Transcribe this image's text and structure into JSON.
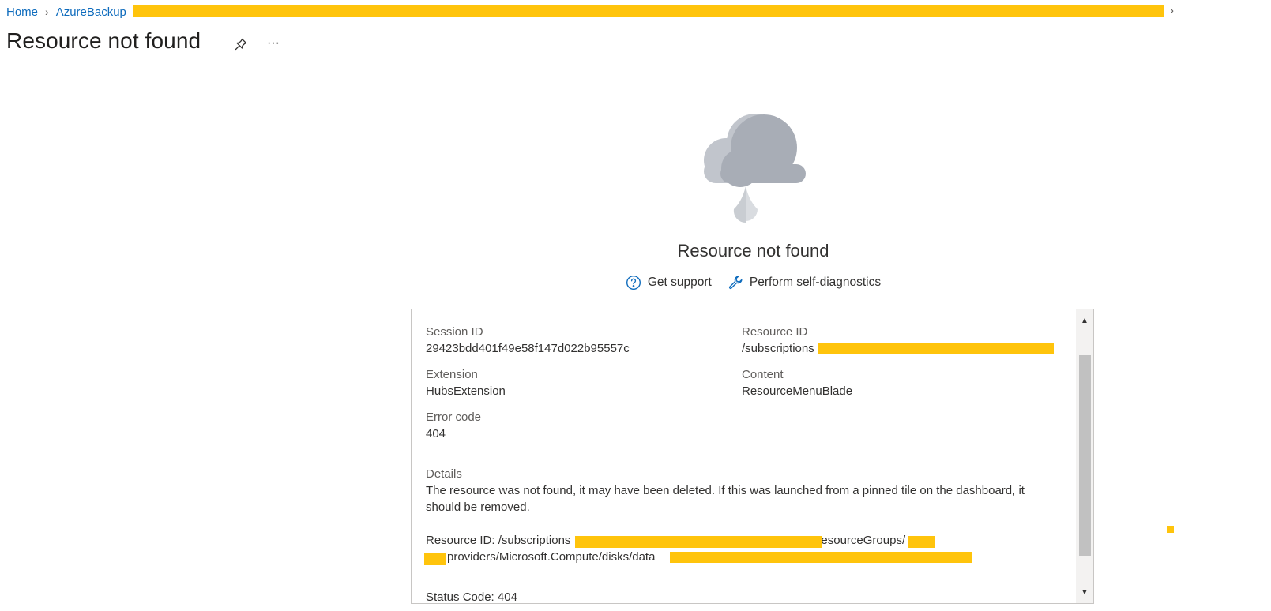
{
  "breadcrumb": {
    "home": "Home",
    "resource": "AzureBackup"
  },
  "header": {
    "title": "Resource not found",
    "more_label": "···"
  },
  "empty_state": {
    "title": "Resource not found",
    "get_support": "Get support",
    "self_diagnostics": "Perform self-diagnostics"
  },
  "details": {
    "session_id_label": "Session ID",
    "session_id": "29423bdd401f49e58f147d022b95557c",
    "resource_id_label": "Resource ID",
    "resource_id_prefix": "/subscriptions",
    "extension_label": "Extension",
    "extension": "HubsExtension",
    "content_label": "Content",
    "content": "ResourceMenuBlade",
    "error_code_label": "Error code",
    "error_code": "404",
    "details_label": "Details",
    "details_line1": "The resource was not found, it may have been deleted. If this was launched from a pinned tile on the dashboard, it",
    "details_line2": "should be removed.",
    "resource_id_line_prefix": "Resource ID: /subscriptions",
    "resource_groups": "resourceGroups/",
    "providers_path": "providers/Microsoft.Compute/disks/data",
    "status_code": "Status Code: 404"
  },
  "colors": {
    "link": "#0f6cbd",
    "redaction": "#ffc40c"
  }
}
